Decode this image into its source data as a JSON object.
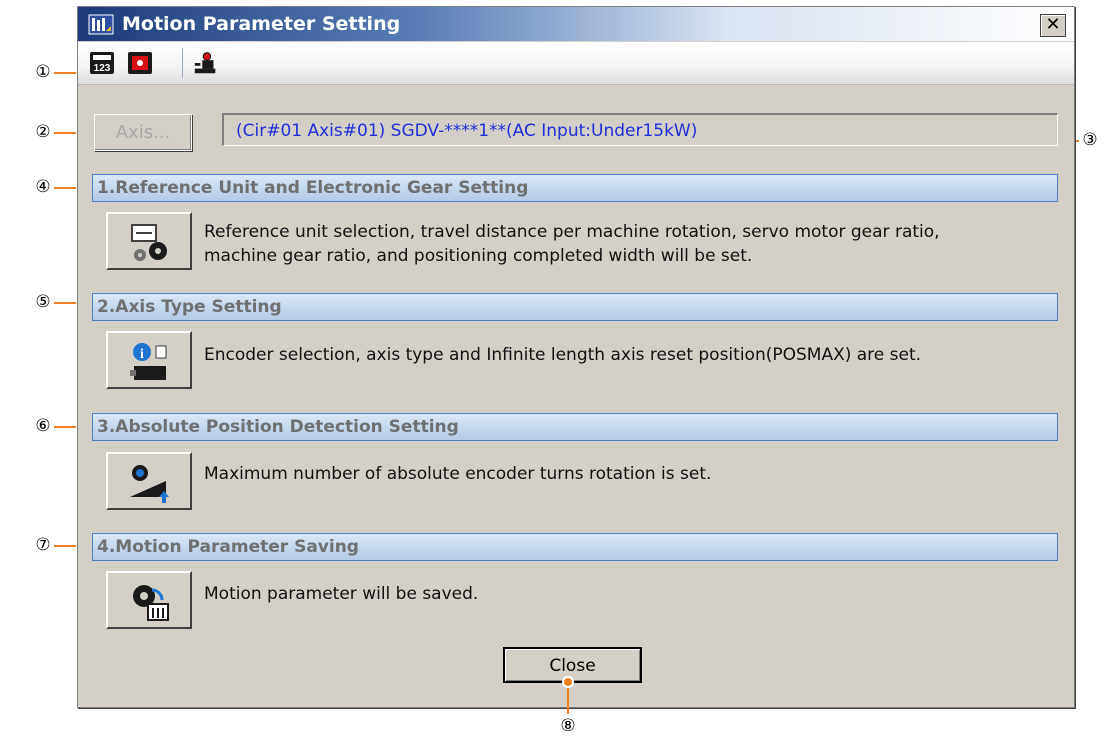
{
  "window": {
    "title": "Motion Parameter Setting",
    "close_glyph": "✕"
  },
  "toolbar": {
    "buttons": [
      {
        "icon": "calculator-icon"
      },
      {
        "icon": "record-icon"
      },
      {
        "icon": "robot-icon"
      }
    ]
  },
  "axis": {
    "button_label": "Axis...",
    "info": "(Cir#01 Axis#01) SGDV-****1**(AC Input:Under15kW)"
  },
  "sections": [
    {
      "header": "1.Reference Unit and Electronic Gear Setting",
      "desc_lines": [
        "Reference unit selection, travel distance per machine rotation, servo motor gear ratio,",
        "machine gear ratio, and positioning completed width will be set."
      ],
      "icon": "gears-settings-icon"
    },
    {
      "header": "2.Axis Type Setting",
      "desc_lines": [
        "Encoder selection, axis type and Infinite length axis reset position(POSMAX) are set."
      ],
      "icon": "info-axis-icon"
    },
    {
      "header": "3.Absolute Position Detection Setting",
      "desc_lines": [
        "Maximum number of absolute encoder turns rotation is set."
      ],
      "icon": "absolute-encoder-icon"
    },
    {
      "header": "4.Motion Parameter Saving",
      "desc_lines": [
        "Motion parameter will be saved."
      ],
      "icon": "save-parameter-icon"
    }
  ],
  "close_label": "Close",
  "callouts": [
    "①",
    "②",
    "③",
    "④",
    "⑤",
    "⑥",
    "⑦",
    "⑧"
  ],
  "colors": {
    "callout": "#f08020",
    "header_text": "#707070",
    "axis_info_text": "#1f2fd8"
  }
}
